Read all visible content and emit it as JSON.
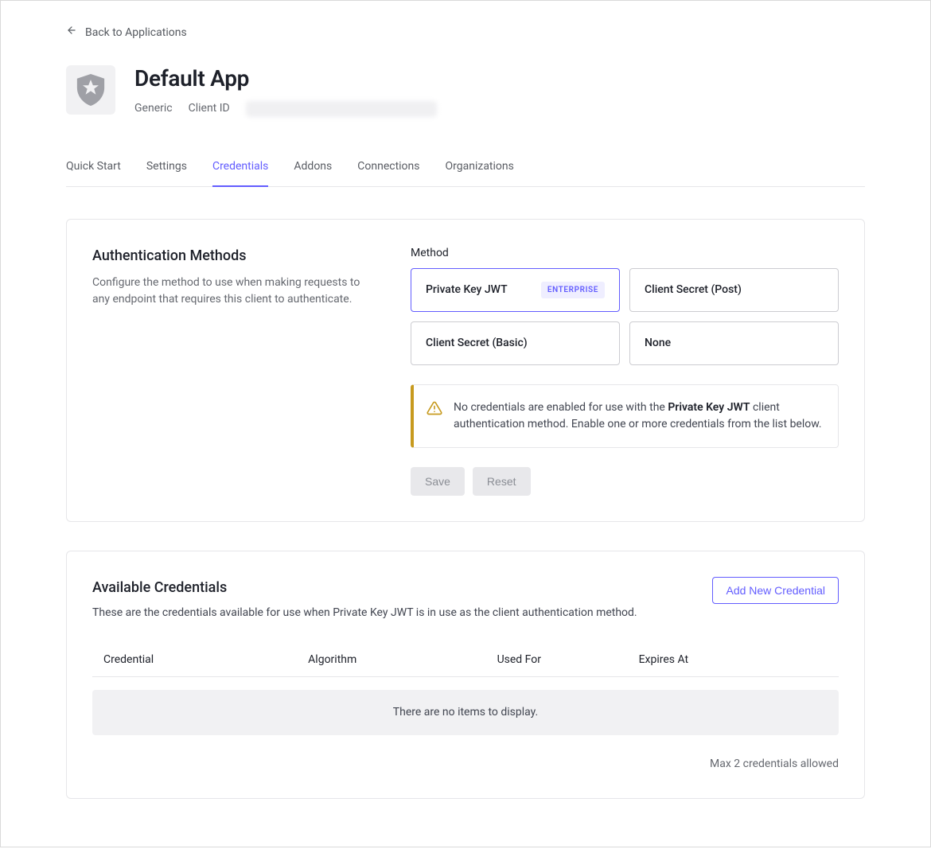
{
  "back_link": "Back to Applications",
  "app": {
    "title": "Default App",
    "type": "Generic",
    "client_id_label": "Client ID"
  },
  "tabs": [
    {
      "label": "Quick Start",
      "active": false
    },
    {
      "label": "Settings",
      "active": false
    },
    {
      "label": "Credentials",
      "active": true
    },
    {
      "label": "Addons",
      "active": false
    },
    {
      "label": "Connections",
      "active": false
    },
    {
      "label": "Organizations",
      "active": false
    }
  ],
  "auth_methods": {
    "heading": "Authentication Methods",
    "description": "Configure the method to use when making requests to any endpoint that requires this client to authenticate.",
    "method_label": "Method",
    "options": [
      {
        "label": "Private Key JWT",
        "badge": "ENTERPRISE",
        "selected": true
      },
      {
        "label": "Client Secret (Post)",
        "selected": false
      },
      {
        "label": "Client Secret (Basic)",
        "selected": false
      },
      {
        "label": "None",
        "selected": false
      }
    ],
    "alert_pre": "No credentials are enabled for use with the ",
    "alert_bold": "Private Key JWT",
    "alert_post": " client authentication method. Enable one or more credentials from the list below.",
    "save_label": "Save",
    "reset_label": "Reset"
  },
  "credentials": {
    "heading": "Available Credentials",
    "description": "These are the credentials available for use when Private Key JWT is in use as the client authentication method.",
    "add_button": "Add New Credential",
    "columns": [
      "Credential",
      "Algorithm",
      "Used For",
      "Expires At"
    ],
    "empty_message": "There are no items to display.",
    "footer_note": "Max 2 credentials allowed"
  }
}
